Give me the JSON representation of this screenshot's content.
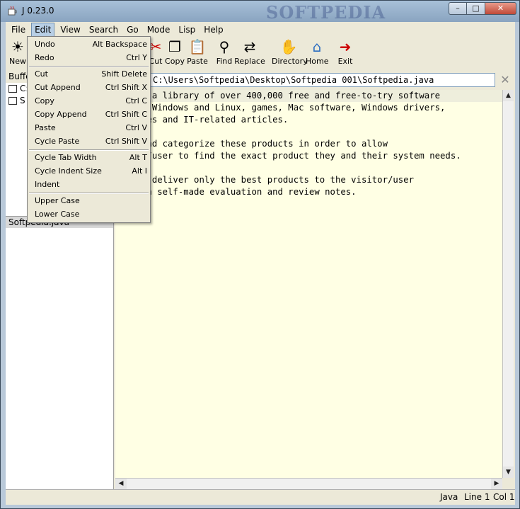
{
  "window": {
    "title": "J 0.23.0",
    "watermark": "SOFTPEDIA",
    "controls": [
      "–",
      "□",
      "✕"
    ]
  },
  "menubar": [
    "File",
    "Edit",
    "View",
    "Search",
    "Go",
    "Mode",
    "Lisp",
    "Help"
  ],
  "toolbar": {
    "new": "New",
    "cut": "Cut",
    "copy": "Copy",
    "paste": "Paste",
    "find": "Find",
    "replace": "Replace",
    "directory": "Directory",
    "home": "Home",
    "exit": "Exit"
  },
  "left_panel": {
    "header": "Buffe",
    "rows": [
      "C:",
      "S"
    ],
    "selected": "Softpedia.java"
  },
  "path": "C:\\Users\\Softpedia\\Desktop\\Softpedia 001\\Softpedia.java",
  "editor_lines": [
    "dia is a library of over 400,000 free and free-to-try software",
    "ms for Windows and Linux, games, Mac software, Windows drivers,",
    " devices and IT-related articles.",
    "",
    "view and categorize these products in order to allow",
    "isitor/user to find the exact product they and their system needs.",
    "",
    "ive to deliver only the best products to the visitor/user",
    "er with self-made evaluation and review notes."
  ],
  "edit_menu": [
    {
      "label": "Undo",
      "accel": "Alt Backspace"
    },
    {
      "label": "Redo",
      "accel": "Ctrl Y"
    },
    {
      "label": "Cut",
      "accel": "Shift Delete"
    },
    {
      "label": "Cut Append",
      "accel": "Ctrl Shift X"
    },
    {
      "label": "Copy",
      "accel": "Ctrl C"
    },
    {
      "label": "Copy Append",
      "accel": "Ctrl Shift C"
    },
    {
      "label": "Paste",
      "accel": "Ctrl V"
    },
    {
      "label": "Cycle Paste",
      "accel": "Ctrl Shift V"
    },
    {
      "label": "Cycle Tab Width",
      "accel": "Alt T"
    },
    {
      "label": "Cycle Indent Size",
      "accel": "Alt I"
    },
    {
      "label": "Indent",
      "accel": ""
    },
    {
      "label": "Upper Case",
      "accel": ""
    },
    {
      "label": "Lower Case",
      "accel": ""
    }
  ],
  "status": {
    "mode": "Java",
    "line": "Line 1",
    "col": "Col 1"
  }
}
